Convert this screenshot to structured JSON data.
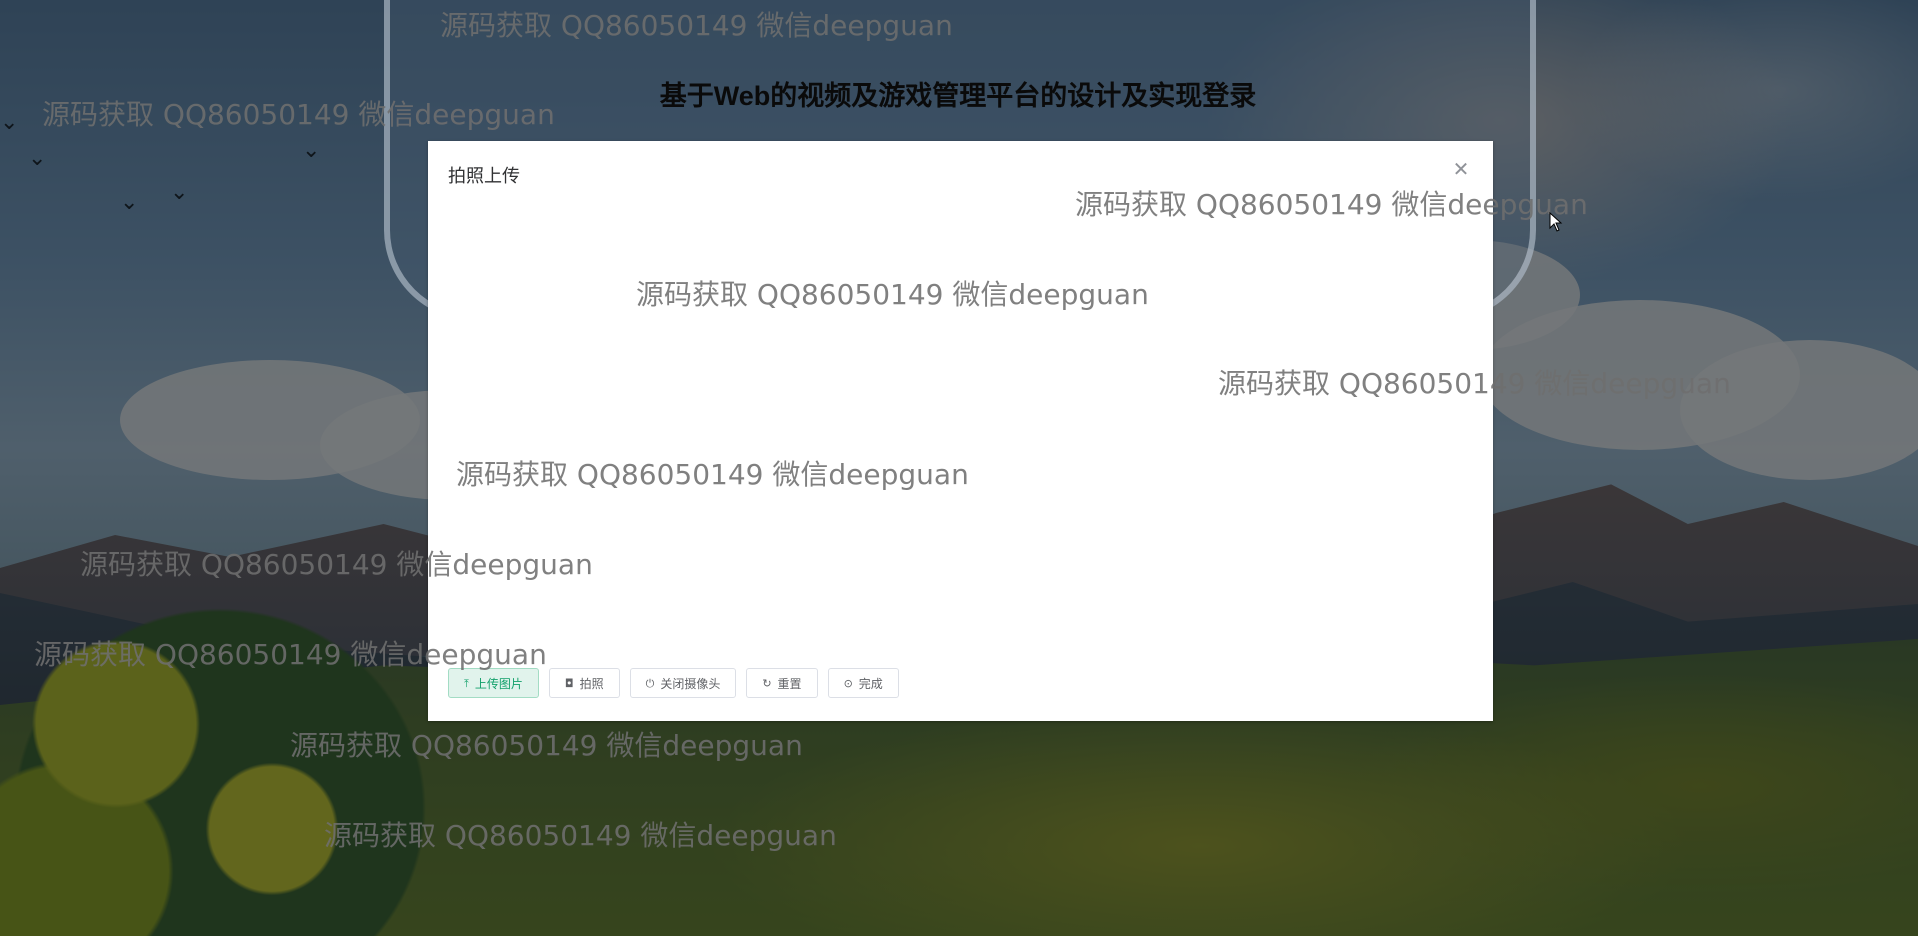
{
  "page": {
    "title": "基于Web的视频及游戏管理平台的设计及实现登录"
  },
  "modal": {
    "title": "拍照上传",
    "close_icon": "close-icon",
    "buttons": [
      {
        "label": "上传图片",
        "icon": "upload-icon",
        "variant": "primary"
      },
      {
        "label": "拍照",
        "icon": "camera-icon",
        "variant": "default"
      },
      {
        "label": "关闭摄像头",
        "icon": "power-icon",
        "variant": "default"
      },
      {
        "label": "重置",
        "icon": "refresh-icon",
        "variant": "default"
      },
      {
        "label": "完成",
        "icon": "circle-check-icon",
        "variant": "default"
      }
    ]
  },
  "watermark": {
    "text": "源码获取 QQ86050149 微信deepguan"
  },
  "colors": {
    "primary_bg": "#e1f3ec",
    "primary_text": "#13a16b",
    "overlay": "rgba(0,0,0,0.5)"
  }
}
